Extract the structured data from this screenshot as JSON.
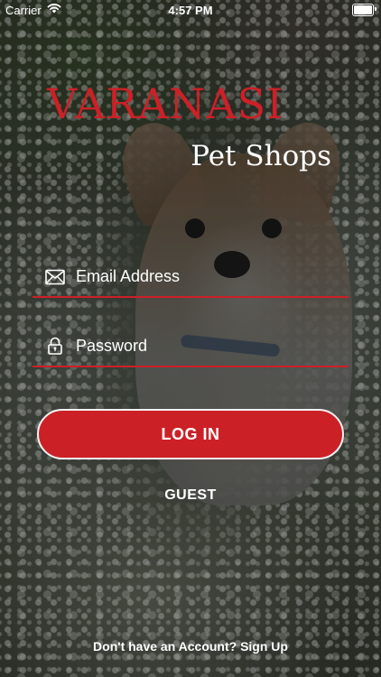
{
  "status_bar": {
    "carrier": "Carrier",
    "time": "4:57 PM",
    "wifi_icon": "wifi-icon",
    "battery_icon": "battery-icon"
  },
  "logo": {
    "title": "VARANASI",
    "subtitle": "Pet Shops"
  },
  "form": {
    "email_placeholder": "Email Address",
    "email_icon": "envelope-icon",
    "password_placeholder": "Password",
    "password_icon": "lock-icon"
  },
  "actions": {
    "login_label": "LOG IN",
    "guest_label": "GUEST",
    "signup_text": "Don't have an Account? Sign Up"
  },
  "colors": {
    "accent": "#cc2027",
    "text": "#ffffff",
    "button_border": "#f2f2f2"
  }
}
